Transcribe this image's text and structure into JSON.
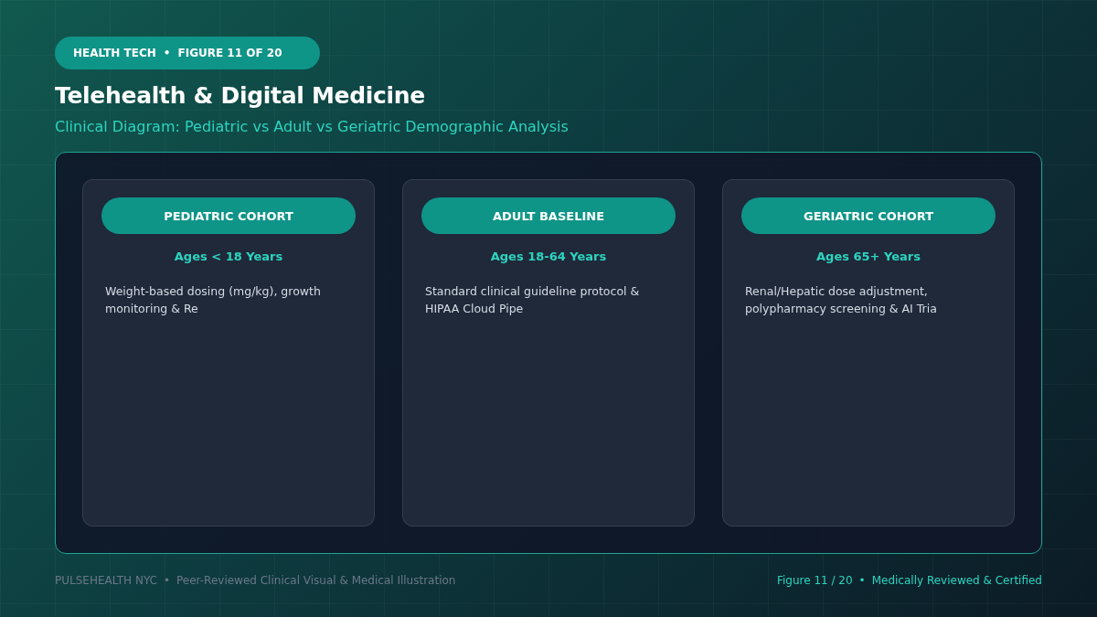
{
  "header": {
    "badge": {
      "category": "HEALTH TECH",
      "separator": "•",
      "figure": "FIGURE 11 OF 20"
    },
    "title": "Telehealth & Digital Medicine",
    "subtitle": "Clinical Diagram: Pediatric vs Adult vs Geriatric Demographic Analysis"
  },
  "cohorts": [
    {
      "label": "PEDIATRIC COHORT",
      "age_range": "Ages < 18 Years",
      "description": "Weight-based dosing (mg/kg), growth monitoring & Re"
    },
    {
      "label": "ADULT BASELINE",
      "age_range": "Ages 18-64 Years",
      "description": "Standard clinical guideline protocol & HIPAA Cloud Pipe"
    },
    {
      "label": "GERIATRIC COHORT",
      "age_range": "Ages 65+ Years",
      "description": "Renal/Hepatic dose adjustment, polypharmacy screening & AI Tria"
    }
  ],
  "footer": {
    "brand": "PULSEHEALTH NYC",
    "separator_left": "•",
    "caption": "Peer-Reviewed Clinical Visual & Medical Illustration",
    "figure": "Figure 11 / 20",
    "separator_right": "•",
    "note": "Medically Reviewed & Certified"
  }
}
